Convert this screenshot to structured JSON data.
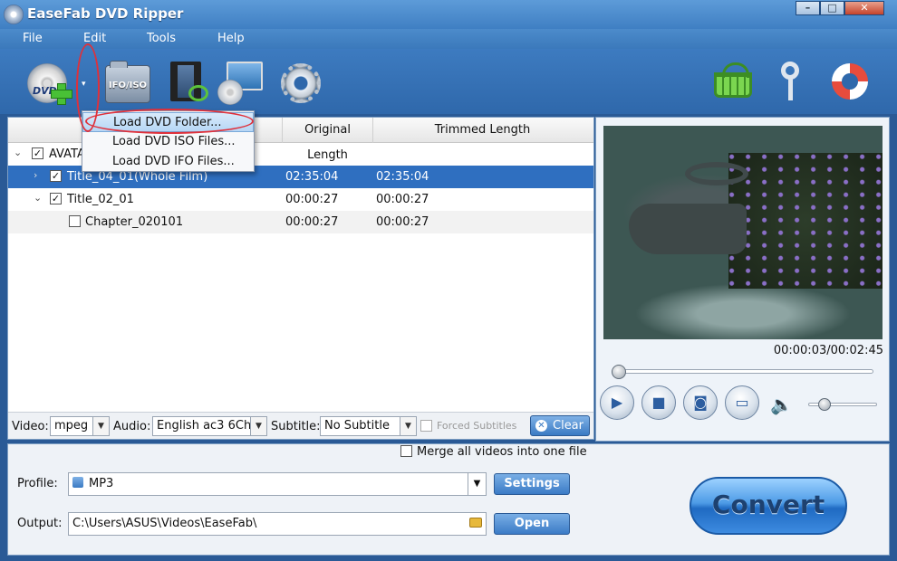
{
  "window": {
    "title": "EaseFab DVD Ripper",
    "minimize": "–",
    "maximize": "□",
    "close": "✕"
  },
  "menu": [
    "File",
    "Edit",
    "Tools",
    "Help"
  ],
  "toolbar": {
    "load_dvd_icon_text": "DVD",
    "ifo_iso_label": "IFO/ISO",
    "dropdown_glyph": "▾"
  },
  "load_menu": [
    "Load DVD Folder...",
    "Load DVD ISO Files...",
    "Load DVD IFO Files..."
  ],
  "list": {
    "columns": [
      "Original Length",
      "Trimmed Length"
    ],
    "rows": [
      {
        "name": "AVATA",
        "original": "",
        "trimmed": ""
      },
      {
        "name": "Title_04_01(Whole Film)",
        "original": "02:35:04",
        "trimmed": "02:35:04"
      },
      {
        "name": "Title_02_01",
        "original": "00:00:27",
        "trimmed": "00:00:27"
      },
      {
        "name": "Chapter_020101",
        "original": "00:00:27",
        "trimmed": "00:00:27"
      }
    ]
  },
  "options": {
    "video_label": "Video:",
    "video_value": "mpeg",
    "audio_label": "Audio:",
    "audio_value": "English ac3 6Ch",
    "subtitle_label": "Subtitle:",
    "subtitle_value": "No Subtitle",
    "forced_label": "Forced Subtitles",
    "clear_label": "Clear"
  },
  "preview": {
    "timecode": "00:00:03/00:02:45",
    "seek_fraction": 0.0,
    "volume_fraction": 0.2
  },
  "bottom": {
    "merge_label": "Merge all videos into one file",
    "profile_label": "Profile:",
    "profile_value": "MP3",
    "settings_label": "Settings",
    "output_label": "Output:",
    "output_value": "C:\\Users\\ASUS\\Videos\\EaseFab\\",
    "open_label": "Open",
    "convert_label": "Convert"
  },
  "colors": {
    "accent": "#2f68ab",
    "selection": "#2f6fc0",
    "annotation": "#e0303a"
  }
}
